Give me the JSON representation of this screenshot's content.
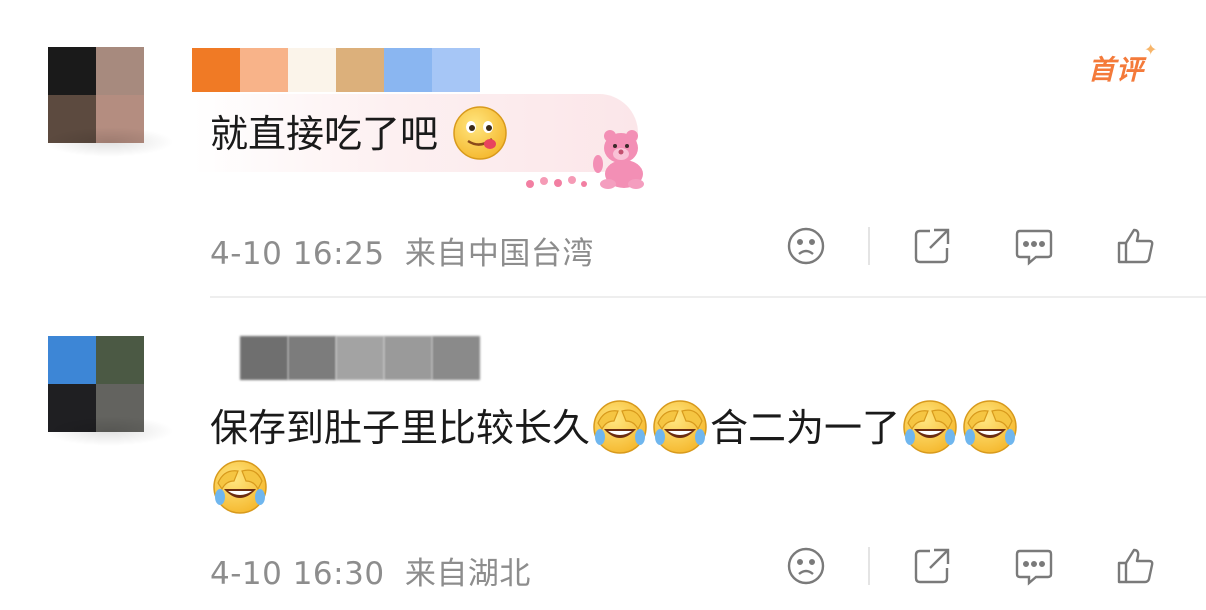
{
  "comments": [
    {
      "text": "就直接吃了吧",
      "emoji": [
        "yum-face-emoji"
      ],
      "time": "4-10 16:25",
      "location": "来自中国台湾",
      "badge": "首评",
      "colors": {
        "avatar": [
          "#1a1a1a",
          "#a78a7e",
          "#5c4a3f",
          "#b48d80"
        ],
        "name": [
          "#f07a25",
          "#f8b389",
          "#fbf4ea",
          "#dcb07b",
          "#8ab6f1",
          "#a6c6f6"
        ]
      }
    },
    {
      "text_before": "保存到肚子里比较长久",
      "text_middle": "合二为一了",
      "emoji": [
        "laugh-cry-emoji"
      ],
      "time": "4-10 16:30",
      "location": "来自湖北",
      "colors": {
        "avatar": [
          "#3d86d6",
          "#4b5944",
          "#1f1f22",
          "#63635f"
        ],
        "name": [
          "#6f6f6f",
          "#7c7c7c",
          "#a3a3a3",
          "#9a9a9a",
          "#8a8a8a"
        ]
      }
    }
  ],
  "actions": [
    "dislike-icon",
    "share-icon",
    "comment-icon",
    "like-icon"
  ],
  "colors": {
    "meta": "#8d8d8d",
    "text": "#1a1a1a",
    "badge": "#f47a3a",
    "icon": "#7a7a7a"
  }
}
